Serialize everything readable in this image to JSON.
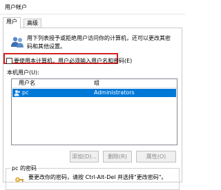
{
  "window": {
    "title": "用户帐户"
  },
  "tabs": [
    {
      "label": "用户"
    },
    {
      "label": "高级"
    }
  ],
  "intro": {
    "text": "用下列表授予或拒绝用户访问你的计算机，还可以更改其密码和其他设置。"
  },
  "require_login": {
    "label": "要使用本计算机，用户必须输入用户名和密码(E)",
    "checked": false
  },
  "users_section": {
    "label": "本机用户(U):"
  },
  "user_list": {
    "columns": [
      "用户名",
      "组"
    ],
    "rows": [
      {
        "user": "pc",
        "group": "Administrators",
        "selected": true
      }
    ]
  },
  "buttons": {
    "add": "添加(D)...",
    "remove": "删除(R)",
    "properties": "属性(O)"
  },
  "password_group": {
    "title": "pc 的密码",
    "text": "要更改你的密码，请按 Ctrl-Alt-Del 并选择\"更改密码\"。"
  },
  "colors": {
    "selection": "#0078d7",
    "highlight_border": "#d32020"
  }
}
